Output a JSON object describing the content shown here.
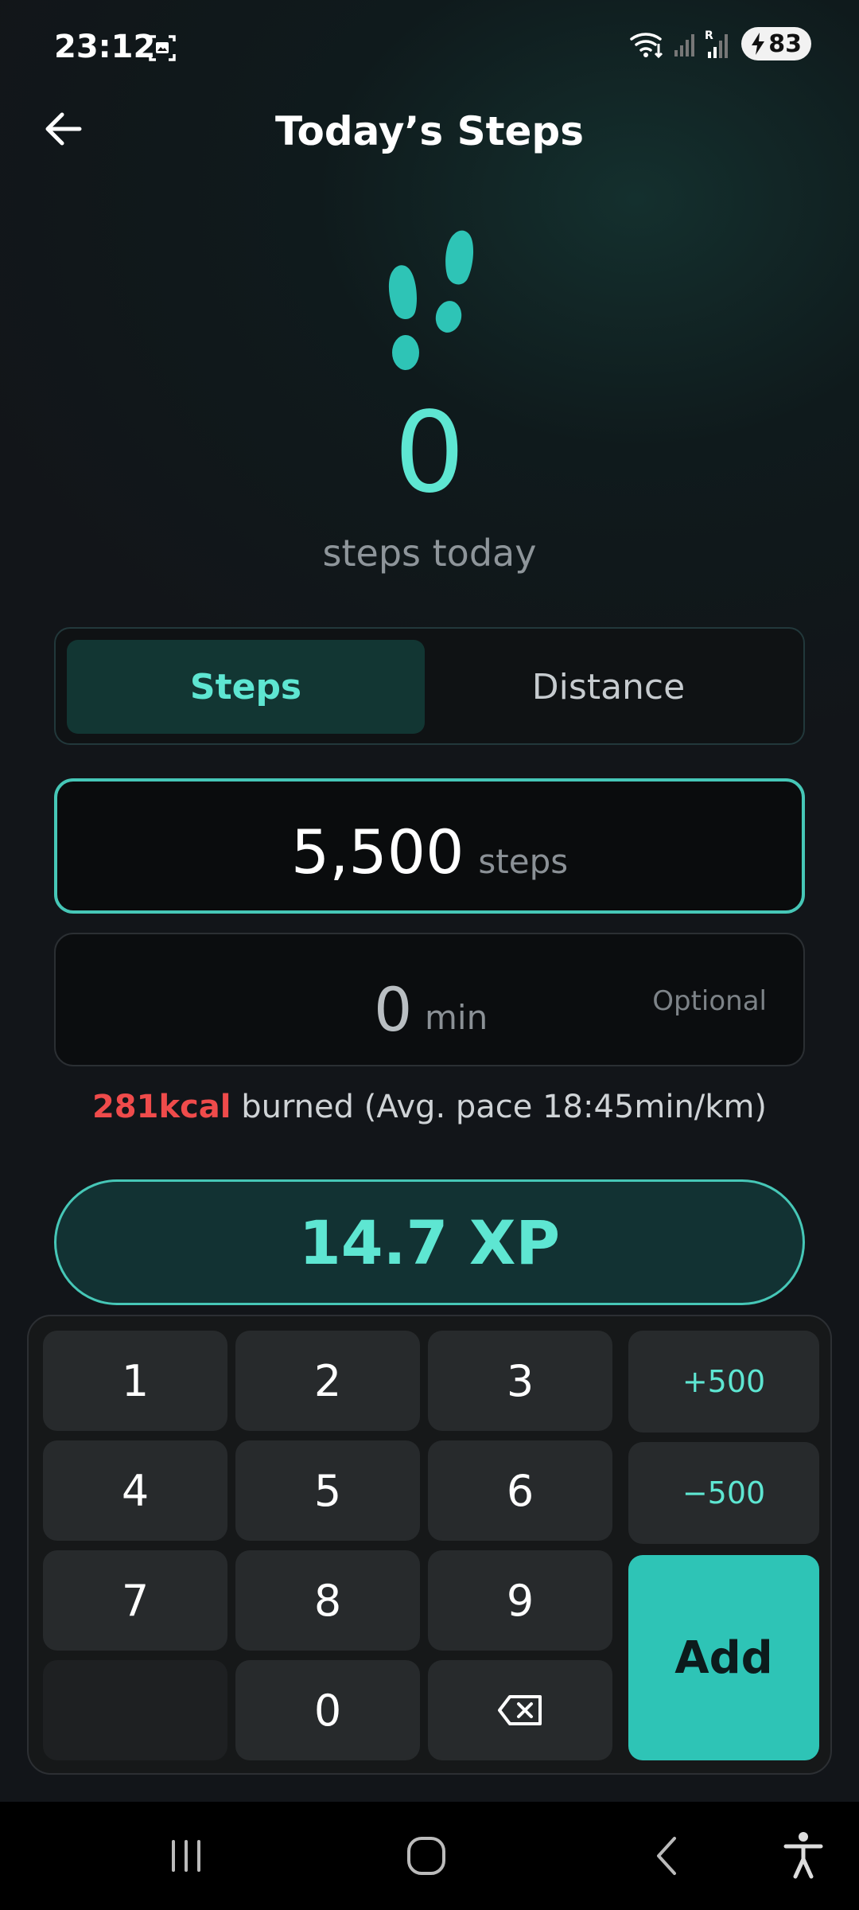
{
  "status_bar": {
    "time": "23:12",
    "battery": "83",
    "icons": [
      "screenshot-icon",
      "wifi-icon",
      "signal-icon",
      "signal-roaming-icon",
      "charging-icon"
    ]
  },
  "header": {
    "title": "Today’s Steps",
    "back_icon": "arrow-left-icon"
  },
  "hero": {
    "icon": "footprints-icon",
    "count": "0",
    "subtitle": "steps today"
  },
  "toggle": {
    "options": [
      "Steps",
      "Distance"
    ],
    "selected": "Steps"
  },
  "steps_input": {
    "value": "5,500",
    "unit": "steps"
  },
  "minutes_input": {
    "value": "0",
    "unit": "min",
    "hint": "Optional"
  },
  "summary": {
    "kcal": "281kcal",
    "burned": " burned",
    "pace": "  (Avg. pace 18:45min/km)"
  },
  "xp": {
    "label": "14.7 XP"
  },
  "keypad": {
    "keys": [
      "1",
      "2",
      "3",
      "4",
      "5",
      "6",
      "7",
      "8",
      "9",
      "0"
    ],
    "plus": "+500",
    "minus": "−500",
    "add": "Add",
    "backspace_icon": "backspace-icon"
  },
  "nav_bar": {
    "icons": [
      "recents-icon",
      "home-icon",
      "back-icon",
      "accessibility-icon"
    ]
  },
  "colors": {
    "accent": "#5ee6d2",
    "accent_button": "#2ec4b6",
    "kcal_red": "#ef4b4b"
  }
}
